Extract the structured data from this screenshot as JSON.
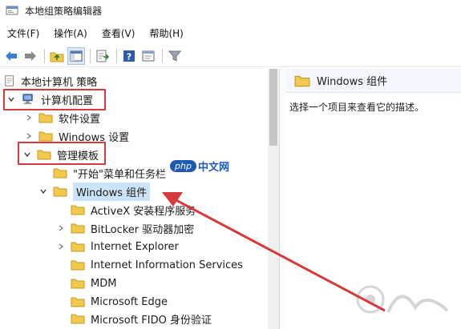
{
  "window": {
    "title": "本地组策略编辑器"
  },
  "menu": [
    {
      "label": "文件(F)"
    },
    {
      "label": "操作(A)"
    },
    {
      "label": "查看(V)"
    },
    {
      "label": "帮助(H)"
    }
  ],
  "toolbar_icons": [
    "back-icon",
    "forward-icon",
    "up-folder-icon",
    "show-hide-tree-icon",
    "export-list-icon",
    "help-icon",
    "properties-icon",
    "filter-icon"
  ],
  "tree": {
    "root": "本地计算机 策略",
    "computer_config": "计算机配置",
    "software_settings": "软件设置",
    "windows_settings": "Windows 设置",
    "admin_templates": "管理模板",
    "start_menu": "\"开始\"菜单和任务栏",
    "windows_components": "Windows 组件",
    "children": [
      {
        "label": "ActiveX 安装程序服务",
        "expandable": false
      },
      {
        "label": "BitLocker 驱动器加密",
        "expandable": true
      },
      {
        "label": "Internet Explorer",
        "expandable": true
      },
      {
        "label": "Internet Information Services",
        "expandable": false
      },
      {
        "label": "MDM",
        "expandable": false
      },
      {
        "label": "Microsoft Edge",
        "expandable": false
      },
      {
        "label": "Microsoft FIDO 身份验证",
        "expandable": false
      }
    ]
  },
  "detail": {
    "header": "Windows 组件",
    "description": "选择一个项目来查看它的描述。"
  },
  "watermark": {
    "badge": "php",
    "text": "中文网"
  },
  "colors": {
    "highlight": "#d63a3a",
    "folder": "#f2c94c",
    "selection": "#cce4f7",
    "watermark": "#1e59b6"
  }
}
